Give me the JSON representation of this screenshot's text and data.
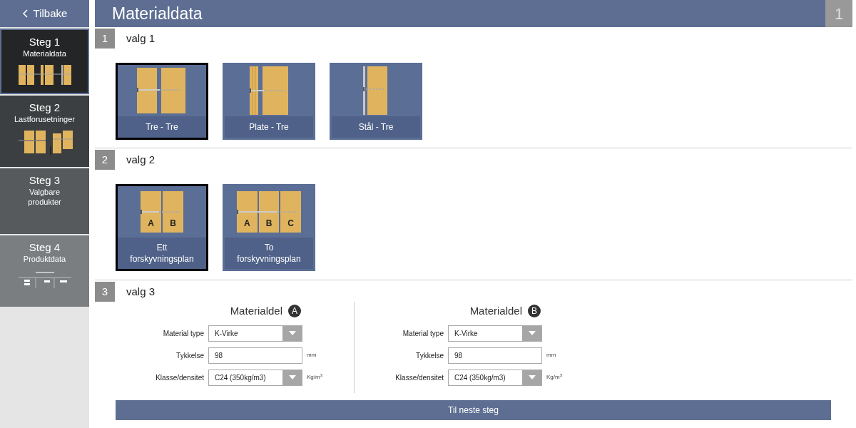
{
  "back": {
    "label": "Tilbake"
  },
  "steps": [
    {
      "title": "Steg 1",
      "subtitle": "Materialdata",
      "selected": true,
      "kind": "material"
    },
    {
      "title": "Steg 2",
      "subtitle": "Lastforusetninger",
      "selected": false,
      "kind": "load"
    },
    {
      "title": "Steg 3",
      "subtitle": "Valgbare produkter",
      "selected": false,
      "kind": "none"
    },
    {
      "title": "Steg 4",
      "subtitle": "Produktdata",
      "selected": false,
      "kind": "table"
    }
  ],
  "header": {
    "title": "Materialdata",
    "step_number": "1"
  },
  "sections": [
    {
      "number": "1",
      "label": "valg 1",
      "options": [
        {
          "label": "Tre - Tre",
          "kind": "tre-tre",
          "selected": true
        },
        {
          "label": "Plate - Tre",
          "kind": "plate-tre",
          "selected": false
        },
        {
          "label": "Stål - Tre",
          "kind": "stal-tre",
          "selected": false
        }
      ]
    },
    {
      "number": "2",
      "label": "valg 2",
      "options": [
        {
          "label": "Ett forskyvningsplan",
          "kind": "lettered",
          "selected": true,
          "letters": [
            "A",
            "B"
          ]
        },
        {
          "label": "To forskyvningsplan",
          "kind": "lettered",
          "selected": false,
          "letters": [
            "A",
            "B",
            "C"
          ]
        }
      ]
    }
  ],
  "section3": {
    "number": "3",
    "label": "valg 3",
    "parts": [
      {
        "title": "Materialdel",
        "badge": "A",
        "fields": [
          {
            "label": "Material type",
            "kind": "select",
            "value": "K-Virke"
          },
          {
            "label": "Tykkelse",
            "kind": "input",
            "value": "98",
            "unit": "mm"
          },
          {
            "label": "Klasse/densitet",
            "kind": "select",
            "value": "C24 (350kg/m3)",
            "unit": "Kg/m$^{3}$"
          }
        ]
      },
      {
        "title": "Materialdel",
        "badge": "B",
        "fields": [
          {
            "label": "Material type",
            "kind": "select",
            "value": "K-Virke"
          },
          {
            "label": "Tykkelse",
            "kind": "input",
            "value": "98",
            "unit": "mm"
          },
          {
            "label": "Klasse/densitet",
            "kind": "select",
            "value": "C24 (350kg/m3)",
            "unit": "Kg/m$^{3}$"
          }
        ]
      }
    ]
  },
  "next_button": {
    "label": "Til neste steg"
  }
}
